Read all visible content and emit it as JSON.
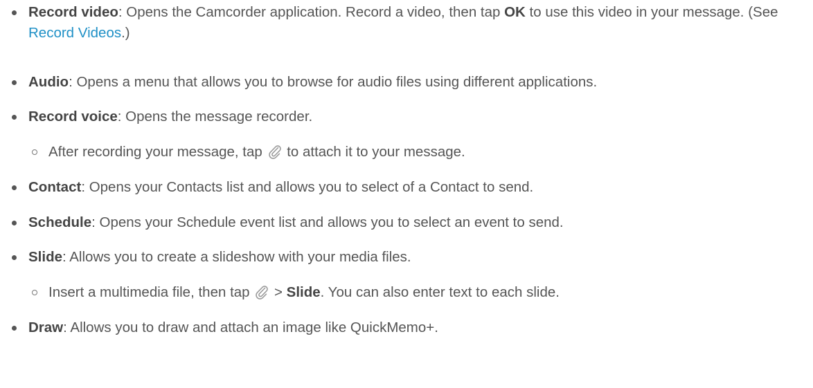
{
  "items": [
    {
      "term": "Record video",
      "parts": [
        ": Opens the Camcorder application. Record a video, then tap ",
        "OK",
        " to use this video in your message. (See ",
        "Record Videos",
        ".)"
      ]
    },
    {
      "term": "Audio",
      "text": ": Opens a menu that allows you to browse for audio files using different applications."
    },
    {
      "term": "Record voice",
      "text": ": Opens the message recorder."
    },
    {
      "term": "Contact",
      "text": ": Opens your Contacts list and allows you to select of a Contact to send."
    },
    {
      "term": "Schedule",
      "text": ": Opens your Schedule event list and allows you to select an event to send."
    },
    {
      "term": "Slide",
      "text": ": Allows you to create a slideshow with your media files."
    },
    {
      "term": "Draw",
      "text": ": Allows you to draw and attach an image like QuickMemo+."
    }
  ],
  "sub_items": [
    {
      "before": "After recording your message, tap ",
      "icon": "paperclip-icon",
      "after": " to attach it to your message."
    },
    {
      "before": "Insert a multimedia file, then tap ",
      "icon": "paperclip-icon",
      "mid": " > ",
      "bold": "Slide",
      "after": ". You can also enter text to each slide."
    }
  ],
  "colors": {
    "text": "#555555",
    "link": "#1f90c6",
    "icon": "#9a9a9a"
  }
}
